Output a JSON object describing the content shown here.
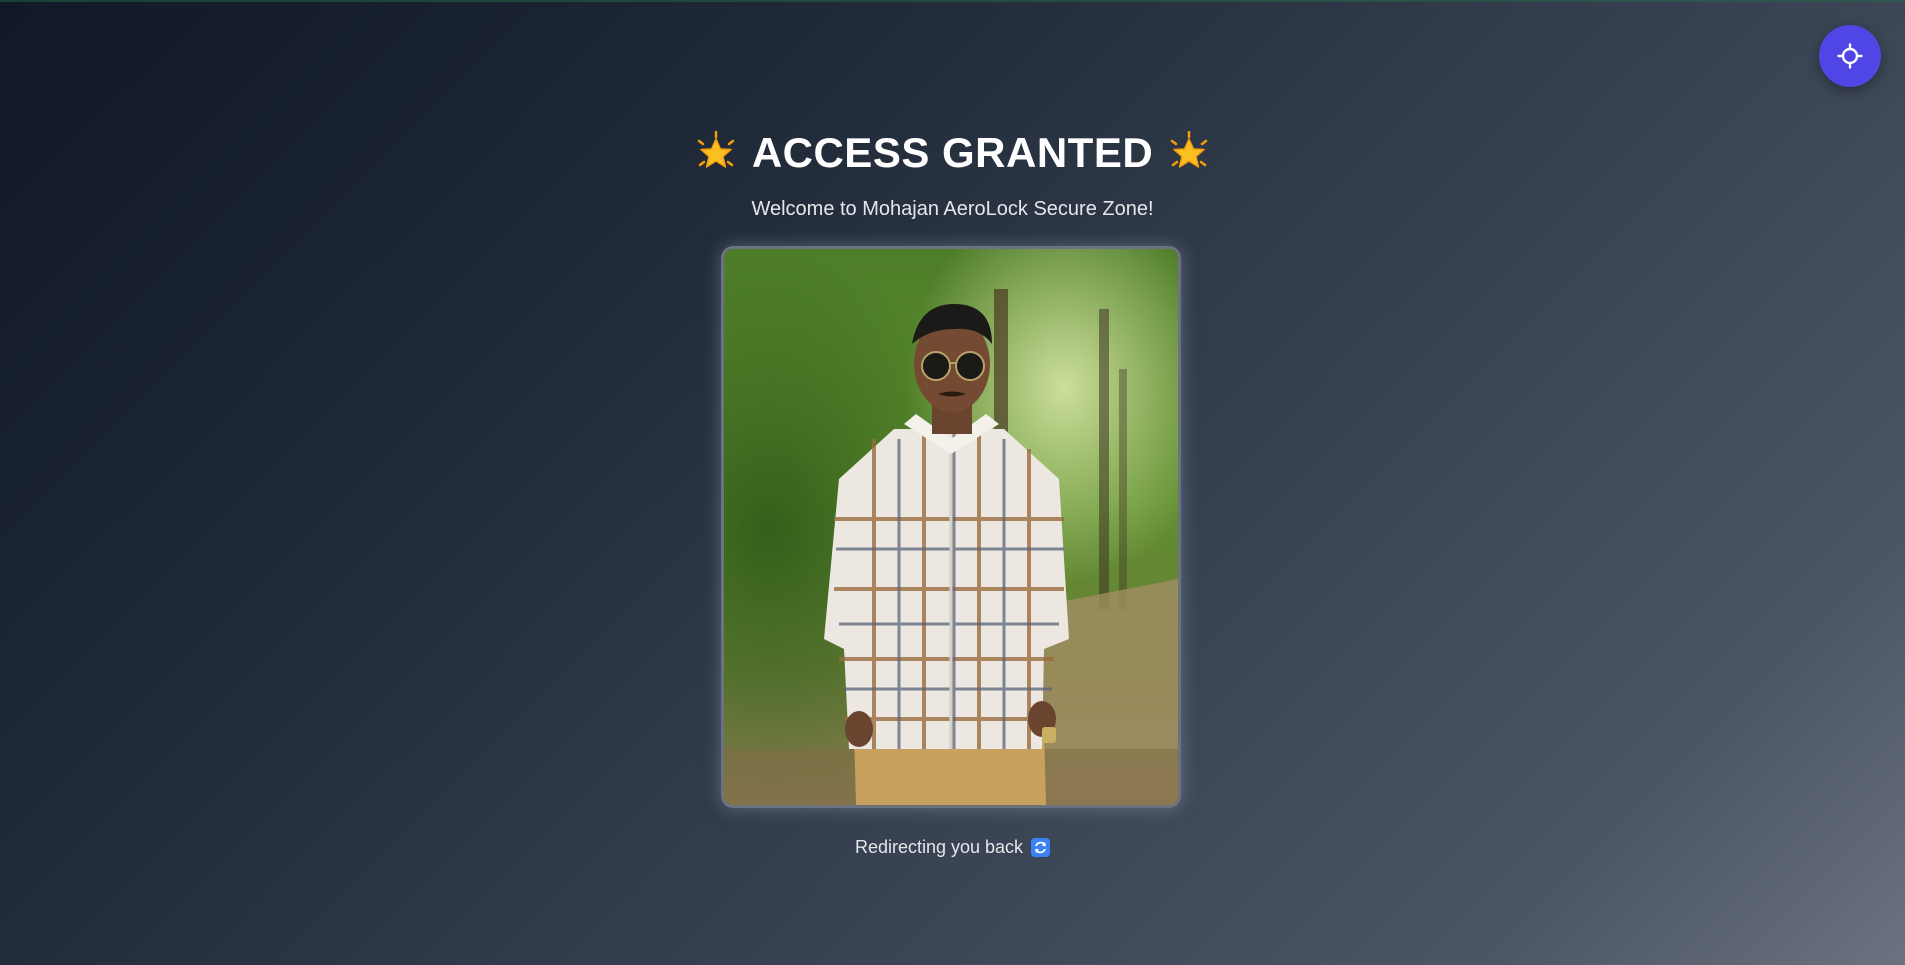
{
  "page": {
    "title": "ACCESS GRANTED",
    "title_icon": "glowing-star-icon",
    "subtitle": "Welcome to Mohajan AeroLock Secure Zone!",
    "redirect_text": "Redirecting you back",
    "redirect_icon": "refresh-arrows-icon"
  },
  "theme_toggle": {
    "icon": "sun-icon"
  },
  "photo": {
    "description_icon": "person-portrait-photo"
  },
  "colors": {
    "accent": "#4f46e5",
    "title": "#ffffff",
    "text": "#e5e7eb",
    "star": "#fbbf24",
    "refresh_badge": "#3b82f6"
  }
}
